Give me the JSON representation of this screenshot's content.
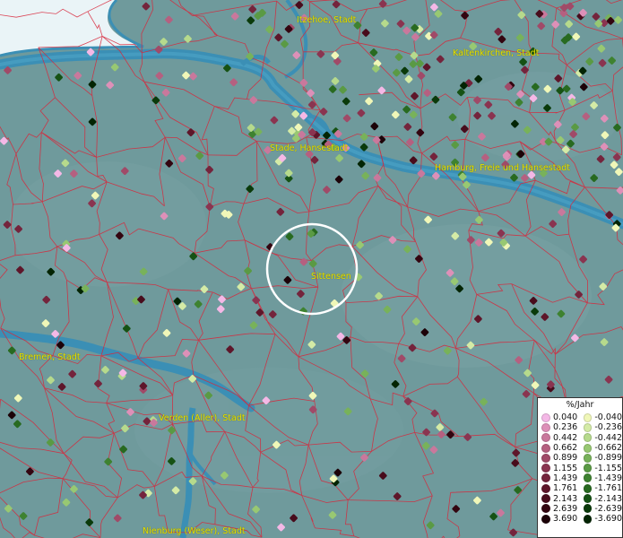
{
  "places": [
    {
      "id": "itzehoe",
      "label": "Itzehoe, Stadt"
    },
    {
      "id": "kaltenkirchen",
      "label": "Kaltenkirchen, Stadt"
    },
    {
      "id": "stade",
      "label": "Stade, Hansestadt"
    },
    {
      "id": "hamburg",
      "label": "Hamburg, Freie und Hansestadt"
    },
    {
      "id": "sittensen",
      "label": "Sittensen"
    },
    {
      "id": "bremen",
      "label": "Bremen, Stadt"
    },
    {
      "id": "verden",
      "label": "Verden (Aller), Stadt"
    },
    {
      "id": "nienburg",
      "label": "Nienburg (Weser), Stadt"
    }
  ],
  "legend": {
    "title": "%/Jahr",
    "positive": [
      {
        "label": "0.040",
        "color": "#f4b8e6"
      },
      {
        "label": "0.236",
        "color": "#dd90b8"
      },
      {
        "label": "0.442",
        "color": "#c9789c"
      },
      {
        "label": "0.662",
        "color": "#b56080"
      },
      {
        "label": "0.899",
        "color": "#a04a68"
      },
      {
        "label": "1.155",
        "color": "#8a3450"
      },
      {
        "label": "1.439",
        "color": "#74243c"
      },
      {
        "label": "1.761",
        "color": "#5e162a"
      },
      {
        "label": "2.143",
        "color": "#480c1c"
      },
      {
        "label": "2.639",
        "color": "#330510"
      },
      {
        "label": "3.690",
        "color": "#1c0208"
      }
    ],
    "negative": [
      {
        "label": "-0.040",
        "color": "#f0f7b8"
      },
      {
        "label": "-0.236",
        "color": "#d4eba6"
      },
      {
        "label": "-0.442",
        "color": "#b6da8c"
      },
      {
        "label": "-0.662",
        "color": "#98c872"
      },
      {
        "label": "-0.899",
        "color": "#78b25a"
      },
      {
        "label": "-1.155",
        "color": "#5a9a44"
      },
      {
        "label": "-1.439",
        "color": "#3e8230"
      },
      {
        "label": "-1.761",
        "color": "#286a20"
      },
      {
        "label": "-2.143",
        "color": "#165214"
      },
      {
        "label": "-2.639",
        "color": "#0a3a0a"
      },
      {
        "label": "-3.690",
        "color": "#032403"
      }
    ]
  },
  "colors": {
    "land": "#6f9a9c",
    "water": "#3b8fb5",
    "sea": "#e8f3f6",
    "borders": "#d8263a",
    "labels": "#e8e000",
    "highlight_circle": "#ffffff"
  }
}
